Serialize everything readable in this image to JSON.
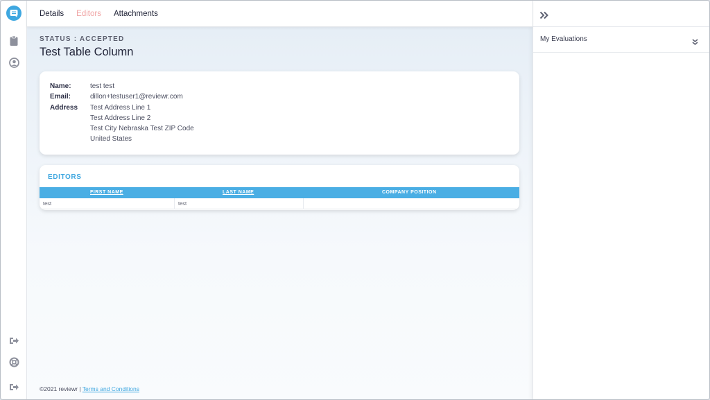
{
  "tabs": [
    {
      "label": "Details",
      "active": false
    },
    {
      "label": "Editors",
      "active": true
    },
    {
      "label": "Attachments",
      "active": false
    }
  ],
  "status": "STATUS : ACCEPTED",
  "title": "Test Table Column",
  "info": {
    "name_label": "Name:",
    "name": "test test",
    "email_label": "Email:",
    "email": "dillon+testuser1@reviewr.com",
    "address_label": "Address",
    "address_lines": [
      "Test Address Line 1",
      "Test Address Line 2",
      "Test City Nebraska Test ZIP Code",
      "United States"
    ]
  },
  "editors": {
    "title": "EDITORS",
    "columns": [
      "FIRST NAME",
      "LAST NAME",
      "COMPANY POSITION"
    ],
    "rows": [
      {
        "first": "test",
        "last": "test",
        "position": ""
      }
    ]
  },
  "footer": {
    "copyright": "©2021 reviewr",
    "separator": "|",
    "terms_link": "Terms and Conditions"
  },
  "right_panel": {
    "section_label": "My Evaluations"
  },
  "colors": {
    "accent": "#3ea7e0",
    "active_tab": "#f0a4a4",
    "table_header": "#4aaee4"
  },
  "icons": {
    "rail_top": [
      "logo-chat-icon",
      "clipboard-icon",
      "user-circle-icon"
    ],
    "rail_bottom": [
      "sign-out-icon",
      "lifebuoy-icon",
      "logout-icon"
    ],
    "panel": [
      "double-chevron-right-icon",
      "double-chevron-down-icon"
    ]
  }
}
